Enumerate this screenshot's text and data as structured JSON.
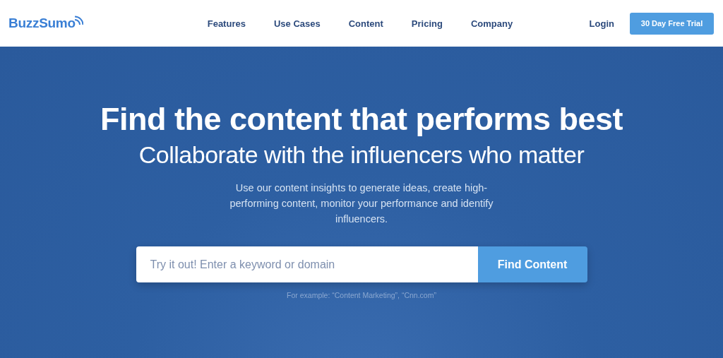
{
  "header": {
    "logo": "BuzzSumo",
    "nav": [
      {
        "label": "Features"
      },
      {
        "label": "Use Cases"
      },
      {
        "label": "Content"
      },
      {
        "label": "Pricing"
      },
      {
        "label": "Company"
      }
    ],
    "login": "Login",
    "trial_button": "30 Day Free Trial"
  },
  "hero": {
    "title": "Find the content that performs best",
    "subtitle": "Collaborate with the influencers who matter",
    "description": "Use our content insights to generate ideas, create high-performing content, monitor your performance and identify influencers.",
    "search": {
      "placeholder": "Try it out! Enter a keyword or domain",
      "button": "Find Content"
    },
    "example": "For example: “Content Marketing”, “Cnn.com”"
  }
}
